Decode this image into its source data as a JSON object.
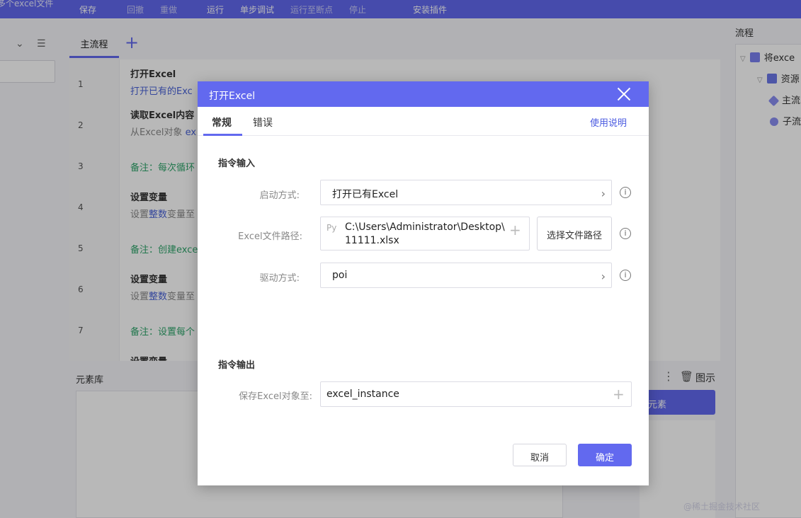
{
  "toolbar": {
    "file_title": "多个excel文件",
    "save": "保存",
    "undo": "回撤",
    "redo": "重做",
    "run": "运行",
    "step_debug": "单步调试",
    "run_to_breakpoint": "运行至断点",
    "stop": "停止",
    "install_plugin": "安装插件"
  },
  "canvas": {
    "main_tab": "主流程",
    "steps": [
      {
        "line": "1",
        "title": "打开Excel",
        "desc": "打开已有的Exc"
      },
      {
        "line": "2",
        "title": "读取Excel内容",
        "desc_pre": "从Excel对象",
        "desc_hl": "ex"
      },
      {
        "line": "3",
        "note": "备注：每次循环"
      },
      {
        "line": "4",
        "title": "设置变量",
        "desc_pre": "设置",
        "desc_hl": "整数",
        "desc_post": "变量至"
      },
      {
        "line": "5",
        "note": "备注：创建exce"
      },
      {
        "line": "6",
        "title": "设置变量",
        "desc_pre": "设置",
        "desc_hl": "整数",
        "desc_post": "变量至"
      },
      {
        "line": "7",
        "note": "备注：设置每个"
      },
      {
        "title": "设置变量"
      }
    ]
  },
  "element_library": {
    "title": "元素库"
  },
  "image_panel": {
    "label": "图示",
    "button": "元素"
  },
  "flow_panel": {
    "title": "流程",
    "tree": [
      "将exce",
      "资源",
      "主流",
      "子流"
    ]
  },
  "dialog": {
    "title": "打开Excel",
    "tabs": [
      "常规",
      "错误"
    ],
    "help": "使用说明",
    "input_section": "指令输入",
    "launch_label": "启动方式:",
    "launch_value": "打开已有Excel",
    "path_label": "Excel文件路径:",
    "path_prefix": "Py",
    "path_value_line1": "C:\\Users\\Administrator\\Desktop\\",
    "path_value_line2": "11111.xlsx",
    "choose_path": "选择文件路径",
    "driver_label": "驱动方式:",
    "driver_value": "poi",
    "output_section": "指令输出",
    "save_label": "保存Excel对象至:",
    "save_value": "excel_instance",
    "cancel": "取消",
    "ok": "确定"
  },
  "watermark": "@稀土掘金技术社区",
  "colors": {
    "accent": "#6269ef",
    "note": "#2fa56b",
    "link": "#4a5ae0"
  }
}
